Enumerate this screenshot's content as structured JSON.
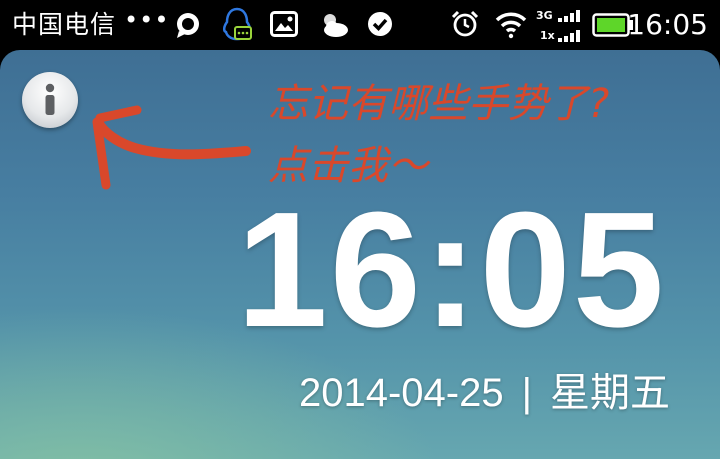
{
  "status_bar": {
    "carrier": "中国电信",
    "dots": "•••",
    "network_top": "3G",
    "network_bottom": "1x",
    "time": "16:05",
    "battery_color": "#5ed629",
    "qq_color": "#2f78e0",
    "icons": [
      "chat-bubble-icon",
      "qq-penguin-icon",
      "gallery-icon",
      "weather-icon",
      "check-circle-icon",
      "alarm-icon",
      "wifi-icon",
      "signal-icon",
      "battery-icon"
    ]
  },
  "lock_screen": {
    "hint_line1": "忘记有哪些手势了?",
    "hint_line2": "点击我～",
    "hint_color": "#d9482b",
    "time": "16:05",
    "date": "2014-04-25",
    "separator": "|",
    "weekday": "星期五"
  }
}
